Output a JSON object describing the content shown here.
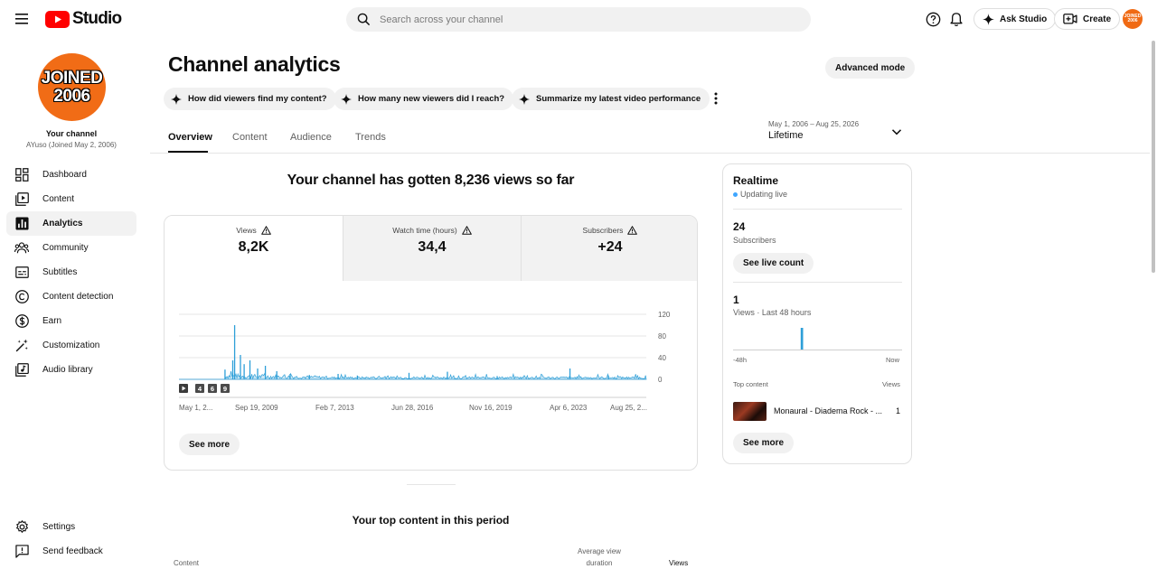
{
  "app": {
    "name": "Studio"
  },
  "search": {
    "placeholder": "Search across your channel"
  },
  "topbar": {
    "ask_label": "Ask Studio",
    "create_label": "Create",
    "avatar_text": [
      "JOINED",
      "2006"
    ]
  },
  "channel": {
    "badge_lines": [
      "JOINED",
      "2006"
    ],
    "label": "Your channel",
    "subtitle": "AYuso (Joined May 2, 2006)"
  },
  "sidebar": {
    "items": [
      {
        "label": "Dashboard",
        "icon": "dashboard-icon"
      },
      {
        "label": "Content",
        "icon": "content-icon"
      },
      {
        "label": "Analytics",
        "icon": "analytics-icon",
        "active": true
      },
      {
        "label": "Community",
        "icon": "community-icon"
      },
      {
        "label": "Subtitles",
        "icon": "subtitles-icon"
      },
      {
        "label": "Content detection",
        "icon": "copyright-icon"
      },
      {
        "label": "Earn",
        "icon": "earn-icon"
      },
      {
        "label": "Customization",
        "icon": "customization-icon"
      },
      {
        "label": "Audio library",
        "icon": "audio-library-icon"
      }
    ],
    "settings_label": "Settings",
    "feedback_label": "Send feedback"
  },
  "page": {
    "title": "Channel analytics",
    "advanced_label": "Advanced mode",
    "chips": [
      "How did viewers find my content?",
      "How many new viewers did I reach?",
      "Summarize my latest video performance"
    ],
    "tabs": [
      "Overview",
      "Content",
      "Audience",
      "Trends"
    ],
    "active_tab": "Overview",
    "date_range": "May 1, 2006 – Aug 25, 2026",
    "date_label": "Lifetime",
    "headline": "Your channel has gotten 8,236 views so far"
  },
  "metrics": [
    {
      "label": "Views",
      "value": "8,2K",
      "selected": true
    },
    {
      "label": "Watch time (hours)",
      "value": "34,4",
      "selected": false
    },
    {
      "label": "Subscribers",
      "value": "+24",
      "selected": false
    }
  ],
  "chart_data": {
    "type": "line",
    "x_tick_labels": [
      "May 1, 2...",
      "Sep 19, 2009",
      "Feb 7, 2013",
      "Jun 28, 2016",
      "Nov 16, 2019",
      "Apr 6, 2023",
      "Aug 25, 2..."
    ],
    "y_ticks": [
      0,
      40,
      80,
      120
    ],
    "ylim": [
      0,
      120
    ],
    "series": [
      {
        "x": [
          "2008-05",
          "2008-09",
          "2008-10",
          "2009-01",
          "2009-03",
          "2009-06",
          "2009-10",
          "2010-02",
          "2010-08",
          "2011-03",
          "2012-01",
          "2013-04",
          "2014-02",
          "2016-05",
          "2018-01",
          "2020-03",
          "2023-05",
          "2025-01"
        ],
        "values": [
          18,
          35,
          100,
          45,
          28,
          35,
          20,
          25,
          15,
          10,
          8,
          10,
          7,
          12,
          14,
          6,
          20,
          7
        ]
      }
    ],
    "color": "#2e9fd8",
    "markers": [
      "4",
      "6",
      "9"
    ],
    "grid": true
  },
  "main_see_more": "See more",
  "realtime": {
    "title": "Realtime",
    "status": "Updating live",
    "subscribers_value": "24",
    "subscribers_label": "Subscribers",
    "live_count_label": "See live count",
    "views_value": "1",
    "views_label": "Views · Last 48 hours",
    "axis_left": "-48h",
    "axis_right": "Now",
    "top_content_label": "Top content",
    "views_col_label": "Views",
    "top_video": {
      "title": "Monaural - Diadema Rock - ...",
      "views": "1"
    },
    "see_more": "See more",
    "bars": [
      0,
      0,
      0,
      0,
      0,
      0,
      0,
      0,
      0,
      0,
      0,
      0,
      0,
      0,
      0,
      0,
      0,
      0,
      0,
      1,
      0,
      0,
      0,
      0,
      0,
      0,
      0,
      0,
      0,
      0,
      0,
      0,
      0,
      0,
      0,
      0,
      0,
      0,
      0,
      0,
      0,
      0,
      0,
      0,
      0,
      0,
      0,
      0
    ]
  },
  "top_content": {
    "title": "Your top content in this period",
    "col_content": "Content",
    "col_avg_line1": "Average view",
    "col_avg_line2": "duration",
    "col_views": "Views"
  }
}
